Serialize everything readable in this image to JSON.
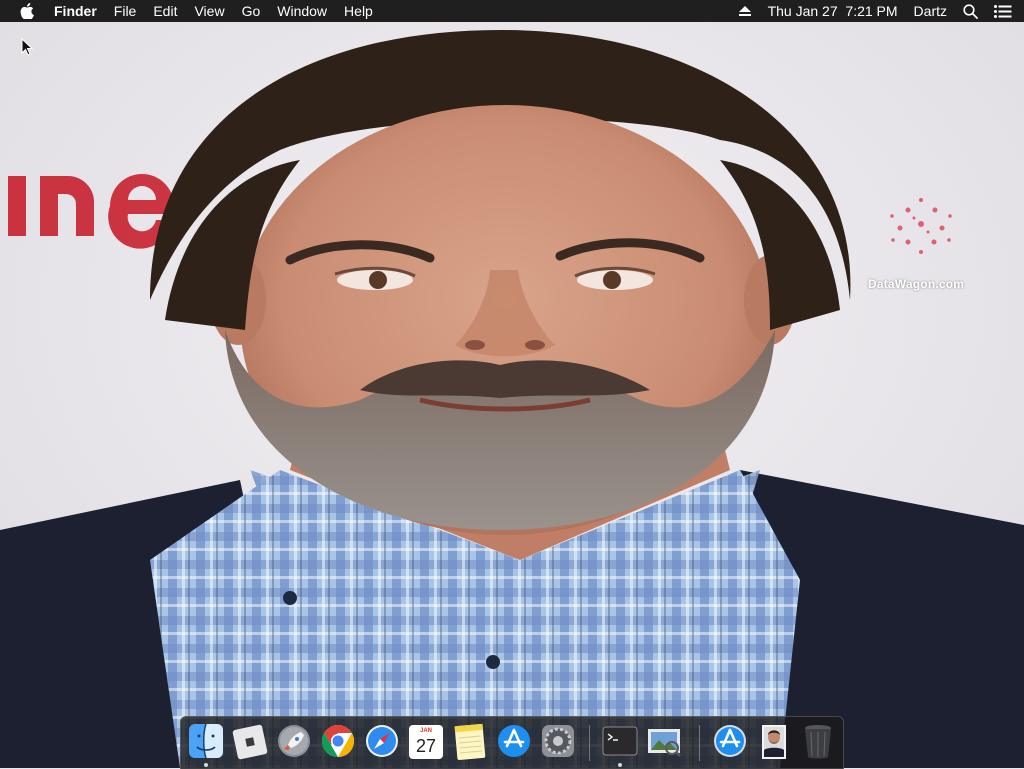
{
  "menubar": {
    "app_name": "Finder",
    "menus": [
      "File",
      "Edit",
      "View",
      "Go",
      "Window",
      "Help"
    ],
    "clock": "Thu Jan 27  7:21 PM",
    "user": "Dartz"
  },
  "desktop": {
    "wallpaper_watermark": "DataWagon.com"
  },
  "dock": {
    "items": [
      {
        "name": "Finder",
        "icon": "finder-icon",
        "running": true
      },
      {
        "name": "Roblox",
        "icon": "roblox-icon",
        "running": false
      },
      {
        "name": "Launchpad",
        "icon": "launchpad-icon",
        "running": false
      },
      {
        "name": "Google Chrome",
        "icon": "chrome-icon",
        "running": false
      },
      {
        "name": "Safari",
        "icon": "safari-icon",
        "running": false
      },
      {
        "name": "Calendar",
        "icon": "calendar-icon",
        "running": false,
        "month": "JAN",
        "day": "27"
      },
      {
        "name": "Notes",
        "icon": "notes-icon",
        "running": false
      },
      {
        "name": "App Store",
        "icon": "app-store-icon",
        "running": false
      },
      {
        "name": "System Preferences",
        "icon": "system-preferences-icon",
        "running": false
      },
      {
        "name": "Terminal",
        "icon": "terminal-icon",
        "running": true
      },
      {
        "name": "Preview",
        "icon": "preview-icon",
        "running": false
      },
      {
        "name": "Downloads",
        "icon": "downloads-stack-icon",
        "running": false
      },
      {
        "name": "Image",
        "icon": "image-thumbnail-icon",
        "running": false
      },
      {
        "name": "Trash",
        "icon": "trash-icon",
        "running": false
      }
    ]
  },
  "colors": {
    "menubar_bg": "#1f1f1f",
    "dock_bg": "#1a1a1c",
    "backdrop_logo": "#c8202f"
  }
}
